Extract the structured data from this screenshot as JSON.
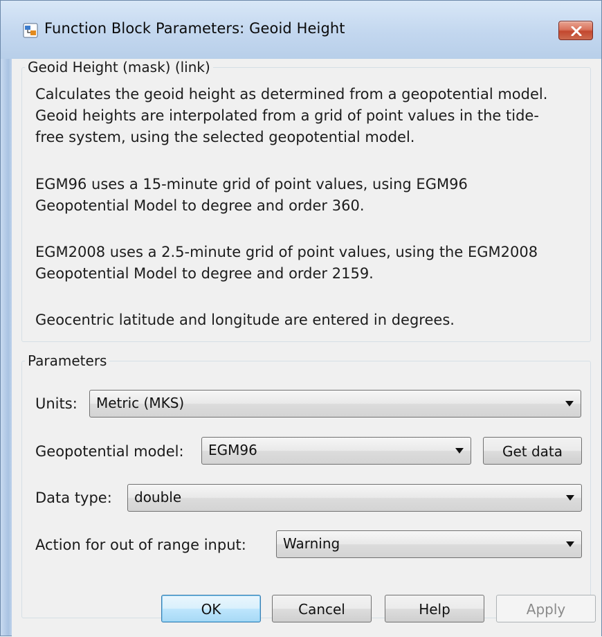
{
  "window": {
    "title": "Function Block Parameters: Geoid Height"
  },
  "description_group": {
    "legend": "Geoid Height (mask) (link)",
    "paragraphs": [
      "Calculates the geoid height as determined from a geopotential model. Geoid heights are interpolated from a grid of point values in the tide-free system, using the selected geopotential model.",
      "EGM96 uses a 15-minute grid of point values, using EGM96 Geopotential Model to degree and order 360.",
      "EGM2008 uses a 2.5-minute grid of point values, using the EGM2008 Geopotential Model to degree and order 2159.",
      "Geocentric latitude and longitude are entered in degrees."
    ],
    "lines": [
      [
        "Calculates the geoid height as determined from a geopotential model.",
        "Geoid heights are interpolated from a grid of point values in the tide-",
        "free system, using the selected geopotential model."
      ],
      [
        "EGM96 uses a 15-minute grid of point values, using EGM96",
        "Geopotential Model to degree and order 360."
      ],
      [
        "EGM2008 uses a 2.5-minute grid of point values, using the EGM2008",
        "Geopotential Model to degree and order 2159."
      ],
      [
        "Geocentric latitude and longitude are entered in degrees."
      ]
    ]
  },
  "parameters_group": {
    "legend": "Parameters",
    "units": {
      "label": "Units:",
      "value": "Metric (MKS)"
    },
    "geopotential_model": {
      "label": "Geopotential model:",
      "value": "EGM96",
      "get_data_label": "Get data"
    },
    "data_type": {
      "label": "Data type:",
      "value": "double"
    },
    "action_out_of_range": {
      "label": "Action for out of range input:",
      "value": "Warning"
    }
  },
  "buttons": {
    "ok": "OK",
    "cancel": "Cancel",
    "help": "Help",
    "apply": "Apply"
  }
}
